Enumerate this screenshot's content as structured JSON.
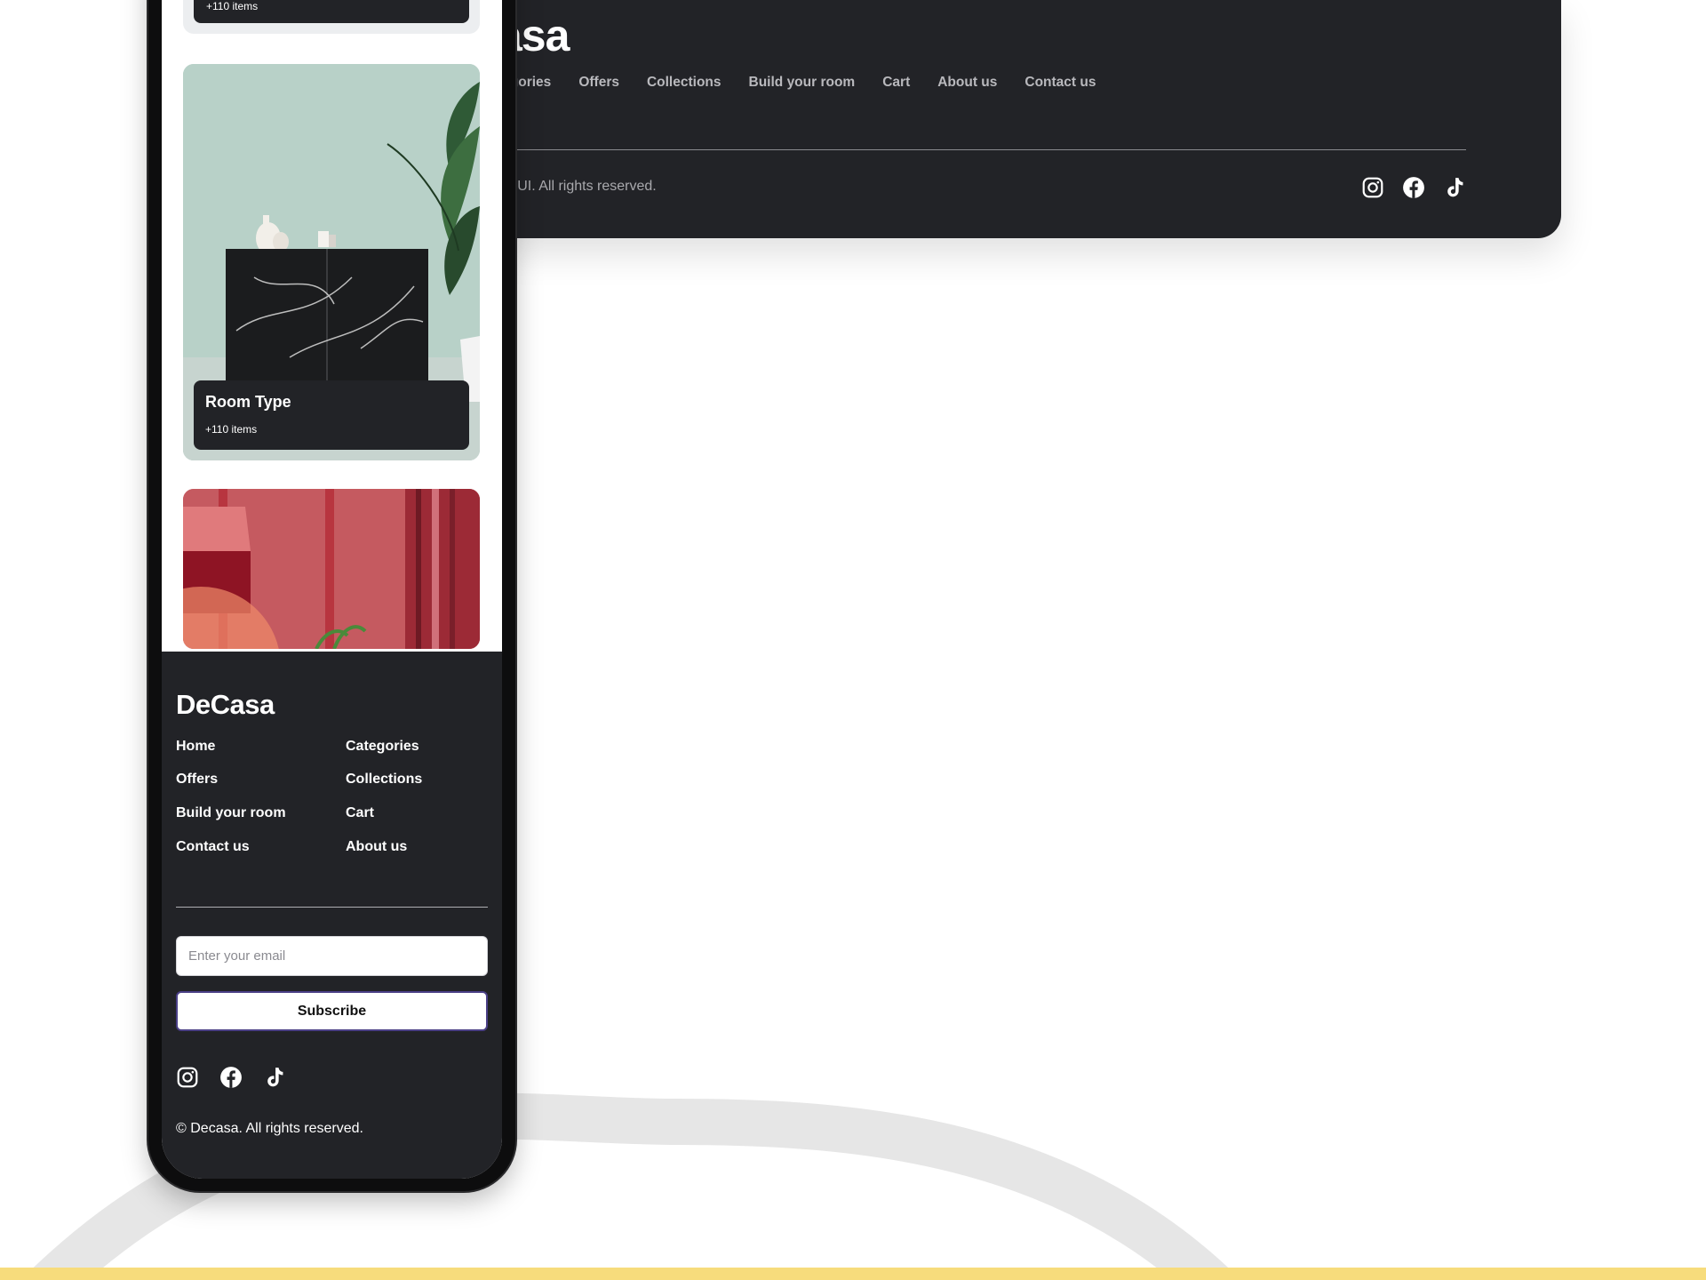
{
  "desktop_footer": {
    "logo": "asa",
    "nav": [
      "tegories",
      "Offers",
      "Collections",
      "Build your room",
      "Cart",
      "About us",
      "Contact us"
    ],
    "copyright": "ed UI. All rights reserved.",
    "social_icons": [
      "instagram-icon",
      "facebook-icon",
      "tiktok-icon"
    ]
  },
  "mobile": {
    "cards": [
      {
        "title": "",
        "items": "+110 items"
      },
      {
        "title": "Room Type",
        "items": "+110 items"
      }
    ],
    "footer": {
      "logo": "DeCasa",
      "nav": {
        "home": "Home",
        "categories": "Categories",
        "offers": "Offers",
        "collections": "Collections",
        "build": "Build your room",
        "cart": "Cart",
        "contact": "Contact us",
        "about": "About us"
      },
      "email_placeholder": "Enter your email",
      "subscribe_label": "Subscribe",
      "social_icons": [
        "instagram-icon",
        "facebook-icon",
        "tiktok-icon"
      ],
      "copyright": "© Decasa. All rights reserved."
    }
  },
  "colors": {
    "footer_bg": "#222327",
    "accent_yellow": "#f7dc7c",
    "button_border": "#4a3f86"
  }
}
